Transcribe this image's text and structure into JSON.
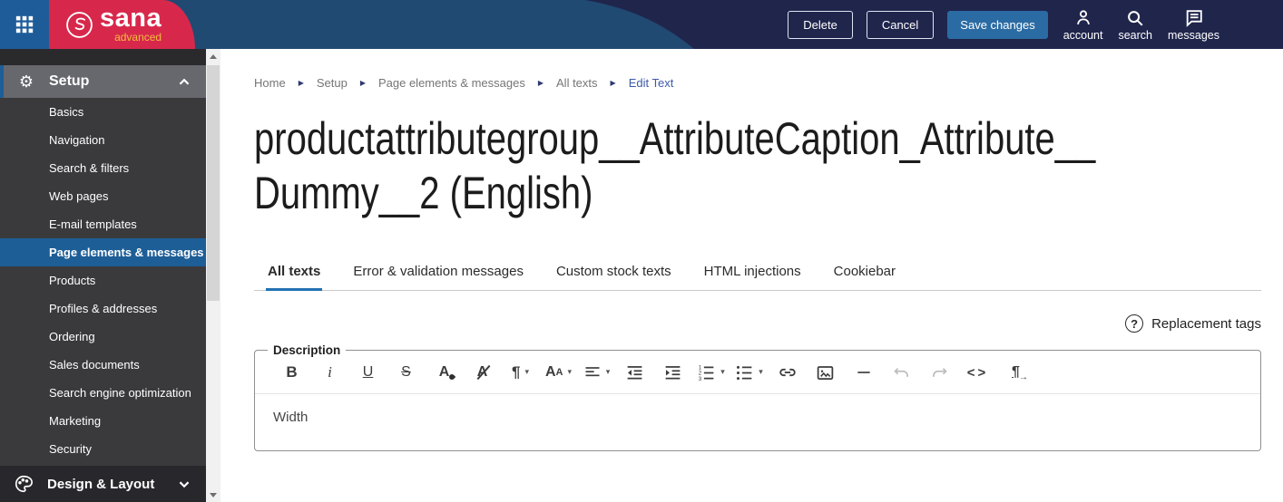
{
  "topbar": {
    "logo": {
      "brand": "sana",
      "tagline": "advanced"
    },
    "actions": {
      "delete": "Delete",
      "cancel": "Cancel",
      "save": "Save changes"
    },
    "quick_links": [
      {
        "label": "account"
      },
      {
        "label": "search"
      },
      {
        "label": "messages"
      }
    ]
  },
  "sidebar": {
    "sections": [
      {
        "label": "Setup",
        "expanded": true
      },
      {
        "label": "Design & Layout",
        "expanded": false
      }
    ],
    "items": [
      {
        "label": "Basics",
        "selected": false
      },
      {
        "label": "Navigation",
        "selected": false
      },
      {
        "label": "Search & filters",
        "selected": false
      },
      {
        "label": "Web pages",
        "selected": false
      },
      {
        "label": "E-mail templates",
        "selected": false
      },
      {
        "label": "Page elements & messages",
        "selected": true
      },
      {
        "label": "Products",
        "selected": false
      },
      {
        "label": "Profiles & addresses",
        "selected": false
      },
      {
        "label": "Ordering",
        "selected": false
      },
      {
        "label": "Sales documents",
        "selected": false
      },
      {
        "label": "Search engine optimization",
        "selected": false
      },
      {
        "label": "Marketing",
        "selected": false
      },
      {
        "label": "Security",
        "selected": false
      }
    ]
  },
  "breadcrumb": {
    "items": [
      "Home",
      "Setup",
      "Page elements & messages",
      "All texts"
    ],
    "separator": "▶",
    "current": "Edit Text"
  },
  "page": {
    "title": "productattributegroup__AttributeCaption_Attribute__Dummy__2 (English)",
    "title_line1": "productattributegroup__AttributeCaption_Attribute__",
    "title_line2": "Dummy__2 (English)"
  },
  "tabs": [
    {
      "label": "All texts",
      "active": true
    },
    {
      "label": "Error & validation messages",
      "active": false
    },
    {
      "label": "Custom stock texts",
      "active": false
    },
    {
      "label": "HTML injections",
      "active": false
    },
    {
      "label": "Cookiebar",
      "active": false
    }
  ],
  "help": {
    "icon": "?",
    "label": "Replacement tags"
  },
  "editor": {
    "legend": "Description",
    "content": "Width",
    "toolbar_icons": [
      "bold",
      "italic",
      "underline",
      "strikethrough",
      "text-color",
      "clear-formatting",
      "paragraph-format",
      "font-size",
      "text-align",
      "decrease-indent",
      "increase-indent",
      "ordered-list",
      "unordered-list",
      "insert-link",
      "insert-image",
      "horizontal-line",
      "undo",
      "redo",
      "code-view",
      "text-direction"
    ],
    "glyphs": {
      "bold": "B",
      "italic": "i",
      "underline": "U",
      "strikethrough": "S",
      "text_color": "A",
      "clear_formatting": "A",
      "paragraph": "¶",
      "font_large": "A",
      "font_small": "A",
      "caret": "▾",
      "code": "<>",
      "direction": "¶",
      "direction_arrow": "→"
    }
  },
  "colors": {
    "topbar_navy": "#20254c",
    "swoosh_blue": "#204a72",
    "brand_red": "#d7284b",
    "app_button_blue": "#1e5c99",
    "accent_blue": "#1d5e97",
    "save_blue": "#2b6ba3",
    "tagline_yellow": "#f0bc3c",
    "tab_underline": "#2272b2"
  }
}
